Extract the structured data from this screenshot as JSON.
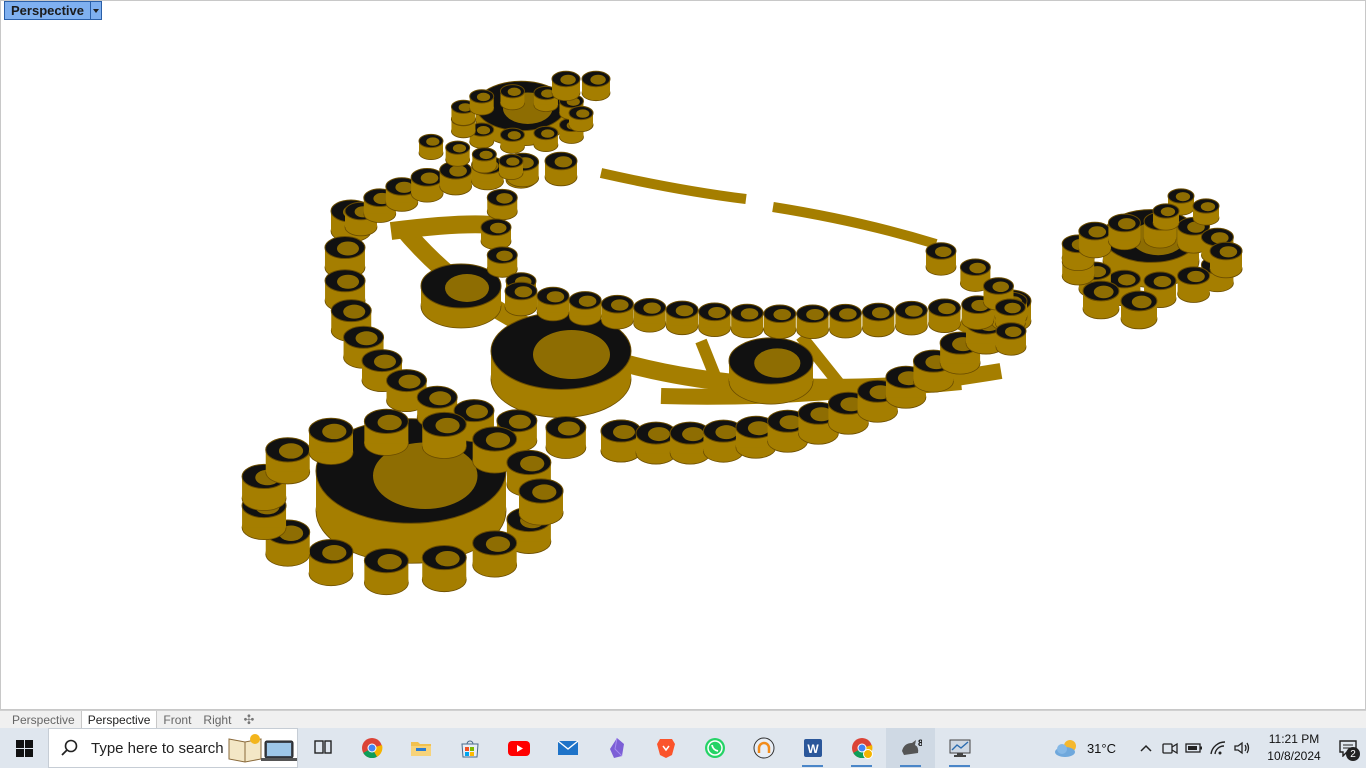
{
  "viewport": {
    "title": "Perspective",
    "scene_color": "#a57e00",
    "scene_edge": "#6b4d00"
  },
  "view_tabs": {
    "tabs": [
      {
        "label": "Perspective",
        "active": false
      },
      {
        "label": "Perspective",
        "active": true
      },
      {
        "label": "Front",
        "active": false
      },
      {
        "label": "Right",
        "active": false
      }
    ],
    "add_icon": "plus-icon"
  },
  "taskbar": {
    "search_placeholder": "Type here to search",
    "apps": [
      {
        "name": "task-view-icon",
        "running": false
      },
      {
        "name": "chrome-icon",
        "running": false
      },
      {
        "name": "file-explorer-icon",
        "running": false
      },
      {
        "name": "microsoft-store-icon",
        "running": false
      },
      {
        "name": "youtube-icon",
        "running": false
      },
      {
        "name": "mail-icon",
        "running": false
      },
      {
        "name": "obsidian-icon",
        "running": false
      },
      {
        "name": "brave-icon",
        "running": false
      },
      {
        "name": "whatsapp-icon",
        "running": false
      },
      {
        "name": "vpn-icon",
        "running": false
      },
      {
        "name": "word-icon",
        "running": true
      },
      {
        "name": "chrome-profile-icon",
        "running": true
      },
      {
        "name": "rhino-8-icon",
        "running": true,
        "active": true
      },
      {
        "name": "display-app-icon",
        "running": true
      }
    ],
    "weather_temp": "31°C",
    "time": "11:21 PM",
    "date": "10/8/2024",
    "notification_count": "2"
  }
}
